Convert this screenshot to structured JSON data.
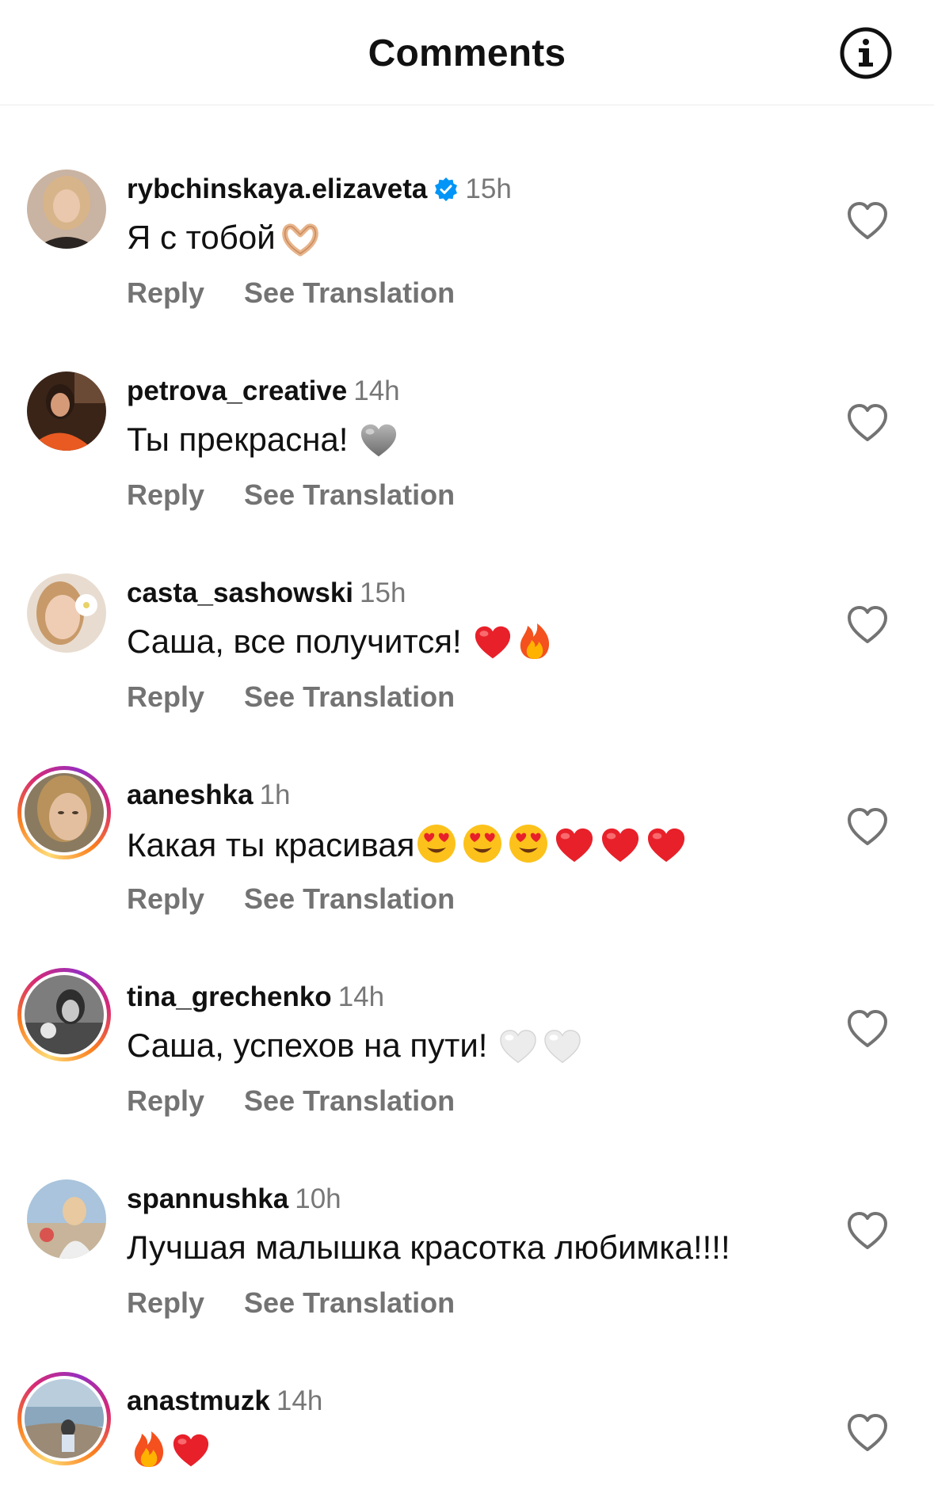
{
  "header": {
    "title": "Comments",
    "info_icon": "info-icon"
  },
  "comments": [
    {
      "username": "rybchinskaya.elizaveta",
      "verified": true,
      "time": "15h",
      "text": "Я с тобой",
      "emojis": [
        "heart-hands"
      ],
      "reply_label": "Reply",
      "translate_label": "See Translation",
      "story_ring": false
    },
    {
      "username": "petrova_creative",
      "verified": false,
      "time": "14h",
      "text": "Ты прекрасна!",
      "emojis": [
        "grey-heart"
      ],
      "reply_label": "Reply",
      "translate_label": "See Translation",
      "story_ring": false
    },
    {
      "username": "casta_sashowski",
      "verified": false,
      "time": "15h",
      "text": "Саша, все получится!",
      "emojis": [
        "red-heart",
        "fire"
      ],
      "reply_label": "Reply",
      "translate_label": "See Translation",
      "story_ring": false
    },
    {
      "username": "aaneshka",
      "verified": false,
      "time": "1h",
      "text": "Какая ты красивая",
      "emojis": [
        "heart-eyes",
        "heart-eyes",
        "heart-eyes",
        "red-heart",
        "red-heart",
        "red-heart"
      ],
      "reply_label": "Reply",
      "translate_label": "See Translation",
      "story_ring": true
    },
    {
      "username": "tina_grechenko",
      "verified": false,
      "time": "14h",
      "text": "Саша, успехов на пути!",
      "emojis": [
        "white-heart",
        "white-heart"
      ],
      "reply_label": "Reply",
      "translate_label": "See Translation",
      "story_ring": true
    },
    {
      "username": "spannushka",
      "verified": false,
      "time": "10h",
      "text": "Лучшая малышка красотка любимка!!!!",
      "emojis": [],
      "reply_label": "Reply",
      "translate_label": "See Translation",
      "story_ring": false
    },
    {
      "username": "anastmuzk",
      "verified": false,
      "time": "14h",
      "text": "",
      "emojis": [
        "fire",
        "red-heart"
      ],
      "reply_label": "",
      "translate_label": "",
      "story_ring": true
    }
  ],
  "colors": {
    "text": "#111111",
    "muted": "#737373",
    "verified": "#0095f6",
    "divider": "#ececec"
  }
}
